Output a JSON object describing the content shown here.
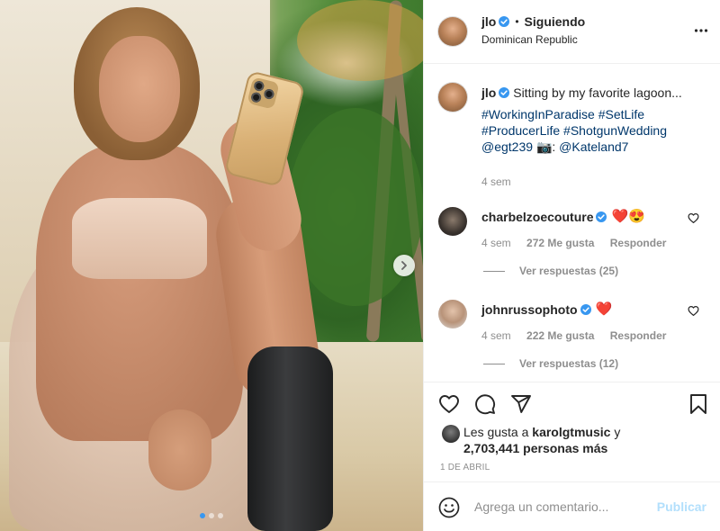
{
  "post": {
    "image_alt": "photo",
    "carousel": {
      "count": 3,
      "active": 0
    }
  },
  "header": {
    "username": "jlo",
    "separator": "•",
    "follow_status": "Siguiendo",
    "location": "Dominican Republic",
    "more_icon": "more-horizontal-icon"
  },
  "caption": {
    "username": "jlo",
    "text": "Sitting by my favorite lagoon...",
    "hashtags_line1": "#WorkingInParadise #SetLife",
    "hashtags_line2": "#ProducerLife #ShotgunWedding",
    "line3_mention": "@egt239",
    "line3_camera": "📷:",
    "line3_mention2": "@Kateland7",
    "time": "4 sem"
  },
  "comments": [
    {
      "username": "charbelzoecouture",
      "emojis": "❤️😍",
      "time": "4 sem",
      "likes": "272 Me gusta",
      "reply_label": "Responder",
      "view_replies": "Ver respuestas (25)"
    },
    {
      "username": "johnrussophoto",
      "emojis": "❤️",
      "time": "4 sem",
      "likes": "222 Me gusta",
      "reply_label": "Responder",
      "view_replies": "Ver respuestas (12)"
    }
  ],
  "likes": {
    "prefix": "Les gusta a",
    "user": "karolgtmusic",
    "conj": "y",
    "count_line": "2,703,441 personas más"
  },
  "date": "1 DE ABRIL",
  "add_comment": {
    "placeholder": "Agrega un comentario...",
    "publish_label": "Publicar"
  },
  "colors": {
    "link": "#00376b",
    "verified": "#3897f0",
    "muted": "#8e8e8e",
    "publish_disabled": "#b2dffc",
    "heart": "#ed4956"
  }
}
